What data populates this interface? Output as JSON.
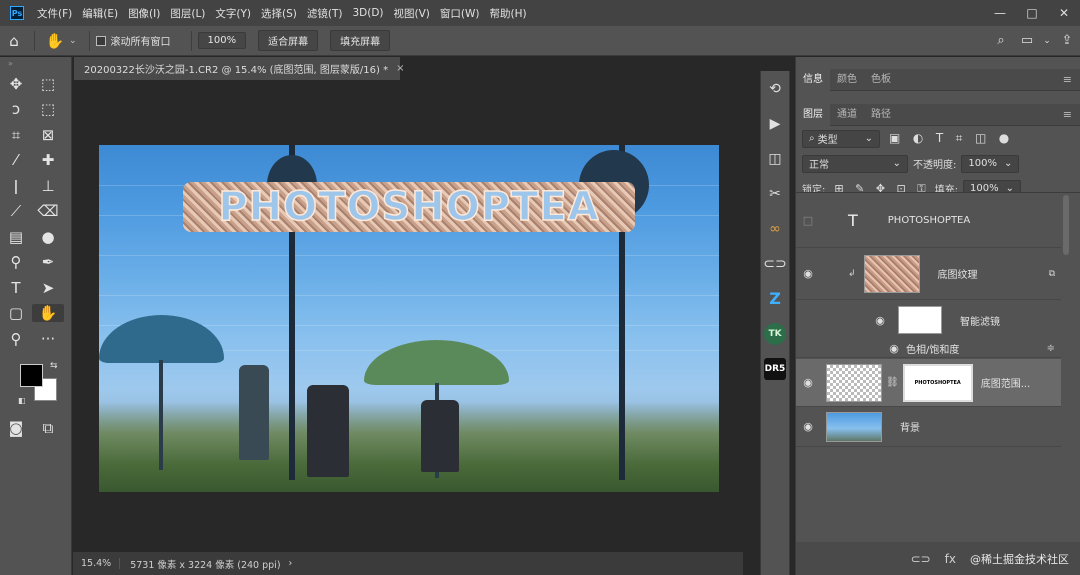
{
  "menu": {
    "logo": "Ps",
    "items": [
      "文件(F)",
      "编辑(E)",
      "图像(I)",
      "图层(L)",
      "文字(Y)",
      "选择(S)",
      "滤镜(T)",
      "3D(D)",
      "视图(V)",
      "窗口(W)",
      "帮助(H)"
    ],
    "window_controls": [
      "—",
      "□",
      "✕"
    ]
  },
  "options": {
    "scroll_all_label": "滚动所有窗口",
    "zoom_value": "100%",
    "fit_screen": "适合屏幕",
    "fill_screen": "填充屏幕"
  },
  "document": {
    "tab_title": "20200322长沙沃之园-1.CR2 @ 15.4% (底图范围, 图层蒙版/16) *",
    "close": "×",
    "overlay_text": "PHOTOSHOPTEA"
  },
  "status": {
    "zoom": "15.4%",
    "info": "5731 像素 x 3224 像素 (240 ppi)",
    "arrow": "›"
  },
  "mid_panel": {
    "badge_z": "Z",
    "badge_tk": "TK",
    "badge_dr": "DR5"
  },
  "panels": {
    "top_tabs": [
      "信息",
      "颜色",
      "色板"
    ],
    "layer_tabs": [
      "图层",
      "通道",
      "路径"
    ],
    "filter_kind": "类型",
    "blend_mode": "正常",
    "opacity_label": "不透明度:",
    "opacity_value": "100%",
    "lock_label": "锁定:",
    "fill_label": "填充:",
    "fill_value": "100%"
  },
  "layers": [
    {
      "name": "PHOTOSHOPTEA",
      "kind": "text"
    },
    {
      "name": "底图纹理",
      "kind": "smart"
    },
    {
      "name": "智能滤镜",
      "kind": "filter-mask"
    },
    {
      "name": "色相/饱和度",
      "kind": "filter"
    },
    {
      "name": "底图范围...",
      "kind": "masked",
      "mask_text": "PHOTOSHOPTEA"
    },
    {
      "name": "背景",
      "kind": "image"
    }
  ],
  "footer": {
    "watermark": "@稀土掘金技术社区"
  },
  "colors": {
    "accent": "#31a8ff",
    "panel_bg": "#535353",
    "canvas_bg": "#282828"
  }
}
